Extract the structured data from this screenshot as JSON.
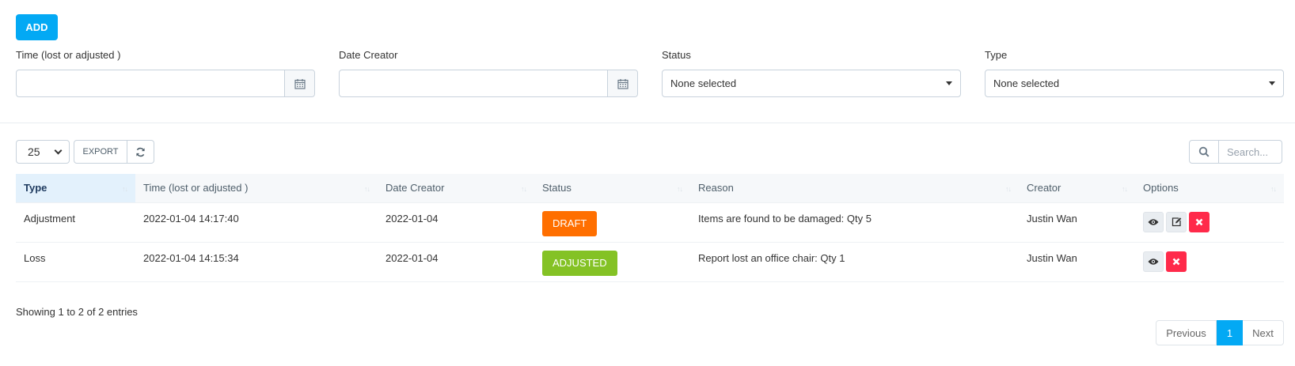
{
  "toolbar": {
    "add_label": "ADD"
  },
  "filters": {
    "time_label": "Time (lost or adjusted )",
    "time_value": "",
    "date_label": "Date Creator",
    "date_value": "",
    "status_label": "Status",
    "status_value": "None selected",
    "type_label": "Type",
    "type_value": "None selected"
  },
  "table_controls": {
    "page_length": "25",
    "export_label": "EXPORT",
    "search_placeholder": "Search..."
  },
  "table": {
    "headers": [
      "Type",
      "Time (lost or adjusted )",
      "Date Creator",
      "Status",
      "Reason",
      "Creator",
      "Options"
    ],
    "rows": [
      {
        "type": "Adjustment",
        "time": "2022-01-04 14:17:40",
        "date": "2022-01-04",
        "status": "DRAFT",
        "reason": "Items are found to be damaged: Qty 5",
        "creator": "Justin Wan"
      },
      {
        "type": "Loss",
        "time": "2022-01-04 14:15:34",
        "date": "2022-01-04",
        "status": "ADJUSTED",
        "reason": "Report lost an office chair: Qty 1",
        "creator": "Justin Wan"
      }
    ]
  },
  "footer": {
    "info": "Showing 1 to 2 of 2 entries",
    "prev_label": "Previous",
    "current_page": "1",
    "next_label": "Next"
  },
  "colors": {
    "accent": "#03a9f4",
    "draft": "#ff6f00",
    "adjusted": "#84c225",
    "danger": "#ff2a4a"
  },
  "icons": {
    "date_picker": "calendar-icon",
    "refresh": "refresh-icon",
    "search": "search-icon",
    "view": "eye-icon",
    "edit": "edit-icon",
    "delete": "close-icon"
  }
}
